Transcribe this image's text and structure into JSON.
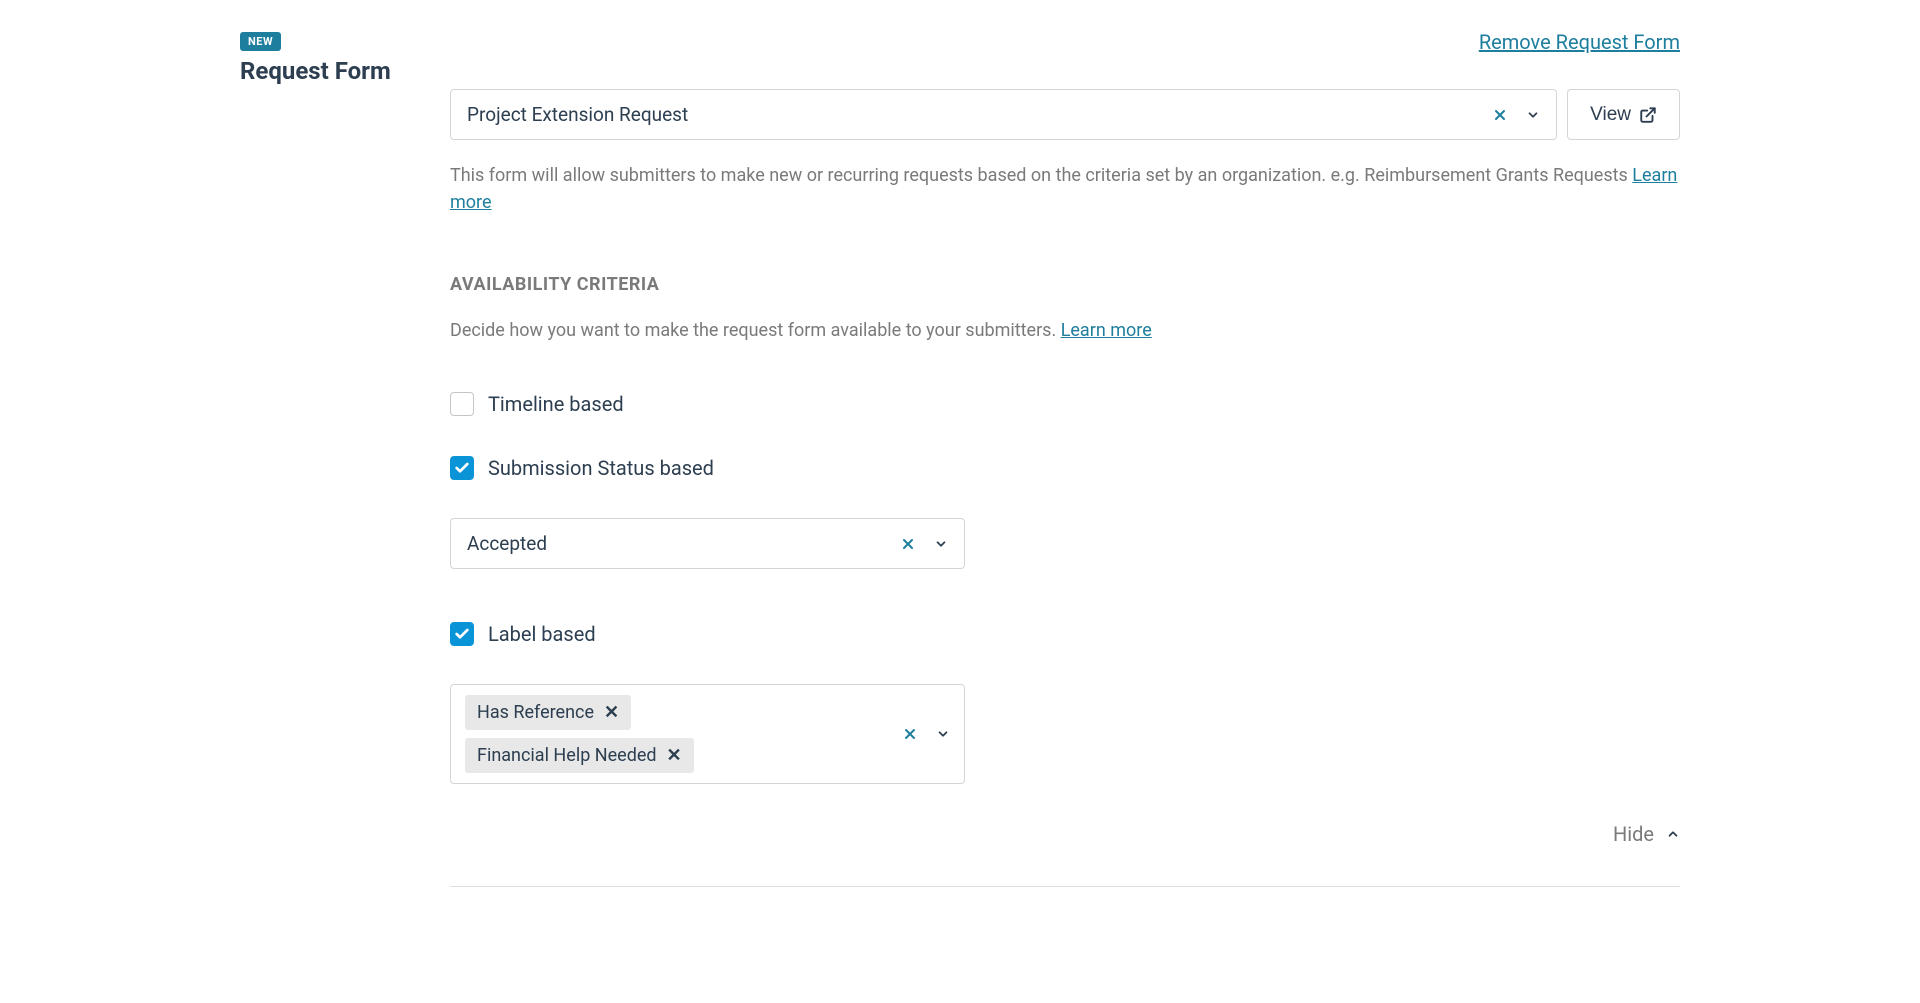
{
  "header": {
    "badge": "NEW",
    "title": "Request Form",
    "remove_link": "Remove Request Form"
  },
  "form_select": {
    "value": "Project Extension Request",
    "view_button": "View"
  },
  "description": {
    "text": "This form will allow submitters to make new or recurring requests based on the criteria set by an organization. e.g. Reimbursement Grants Requests ",
    "learn_more": "Learn more"
  },
  "availability": {
    "title": "AVAILABILITY CRITERIA",
    "description": "Decide how you want to make the request form available to your submitters. ",
    "learn_more": "Learn more"
  },
  "criteria": {
    "timeline": {
      "label": "Timeline based",
      "checked": false
    },
    "submission_status": {
      "label": "Submission Status based",
      "checked": true,
      "value": "Accepted"
    },
    "label_based": {
      "label": "Label based",
      "checked": true,
      "tags": [
        "Has Reference",
        "Financial Help Needed"
      ]
    }
  },
  "footer": {
    "hide": "Hide"
  }
}
